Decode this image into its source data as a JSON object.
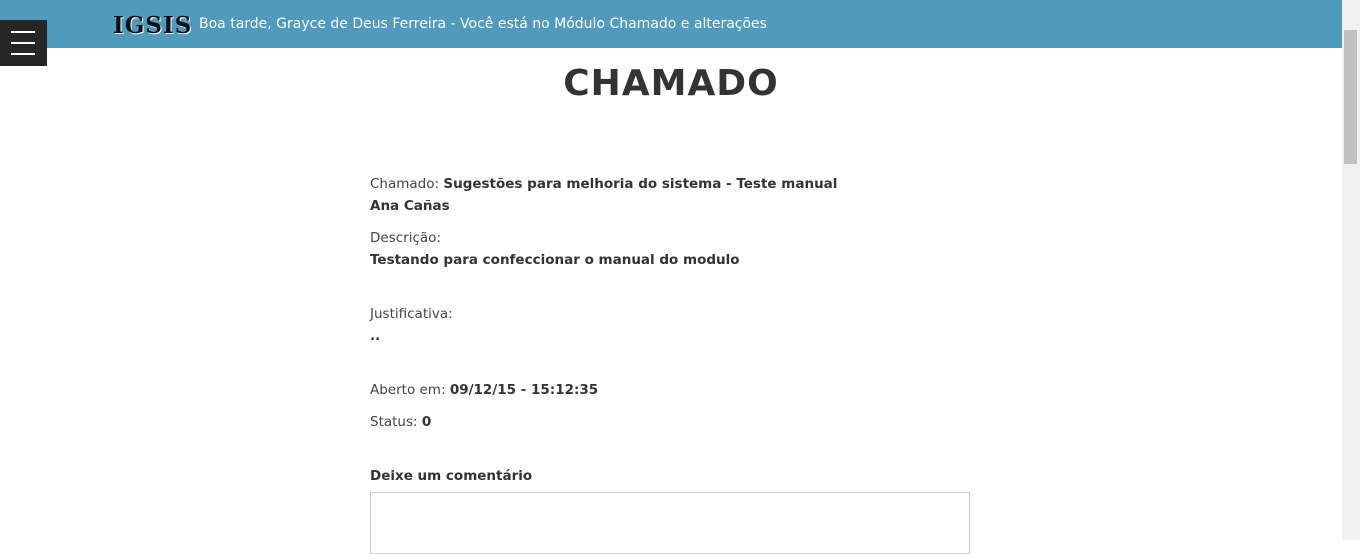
{
  "header": {
    "logo": "IGSIS",
    "greeting": "Boa tarde, Grayce de Deus Ferreira - Você está no Módulo Chamado e alterações"
  },
  "page": {
    "title": "CHAMADO"
  },
  "ticket": {
    "chamado_label": "Chamado: ",
    "chamado_value": "Sugestões para melhoria do sistema - Teste manual",
    "author": "Ana Cañas",
    "descricao_label": "Descrição:",
    "descricao_value": "Testando para confeccionar o manual do modulo",
    "justificativa_label": "Justificativa:",
    "justificativa_value": "..",
    "aberto_label": "Aberto em: ",
    "aberto_value": "09/12/15 - 15:12:35",
    "status_label": "Status: ",
    "status_value": "0"
  },
  "comment": {
    "label": "Deixe um comentário",
    "value": ""
  },
  "icons": {
    "menu": "hamburger-menu-icon"
  },
  "colors": {
    "topbar": "#4f9abd",
    "menu_button": "#262626"
  }
}
